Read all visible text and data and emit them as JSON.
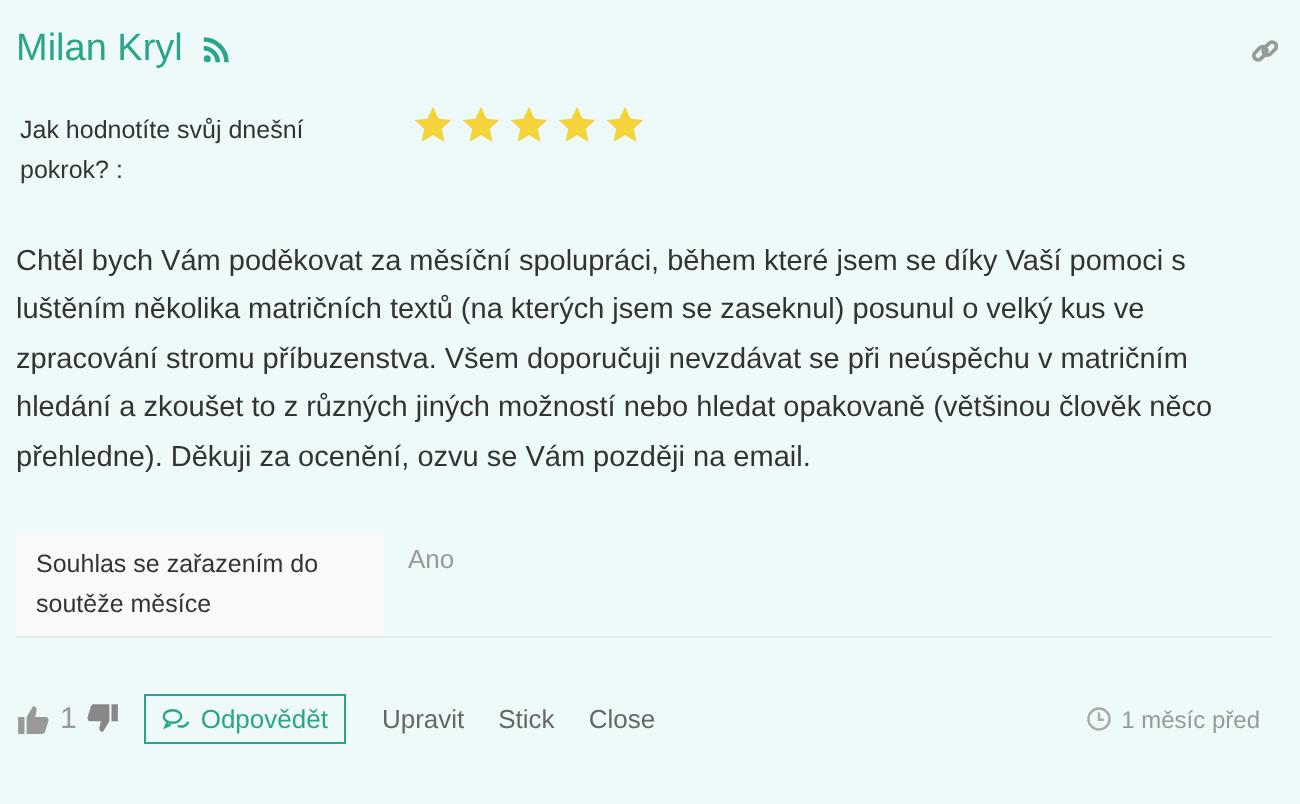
{
  "author": {
    "name": "Milan Kryl"
  },
  "rating": {
    "label": "Jak hodnotíte svůj dnešní pokrok? :",
    "stars": 5
  },
  "message": "Chtěl bych Vám poděkovat za měsíční spolupráci, během které jsem se díky Vaší pomoci s luštěním několika matričních textů (na kterých jsem se zaseknul) posunul o velký kus ve zpracování stromu příbuzenstva. Všem doporučuji nevzdávat se při neúspěchu v matričním hledání a zkoušet to z různých jiných možností nebo hledat opakovaně (většinou člověk něco přehledne). Děkuji za ocenění, ozvu se Vám později na email.",
  "fields": [
    {
      "label": "Souhlas se zařazením do soutěže měsíce",
      "value": "Ano"
    }
  ],
  "footer": {
    "likes": "1",
    "reply": "Odpovědět",
    "actions": [
      "Upravit",
      "Stick",
      "Close"
    ],
    "time": "1 měsíc před"
  }
}
